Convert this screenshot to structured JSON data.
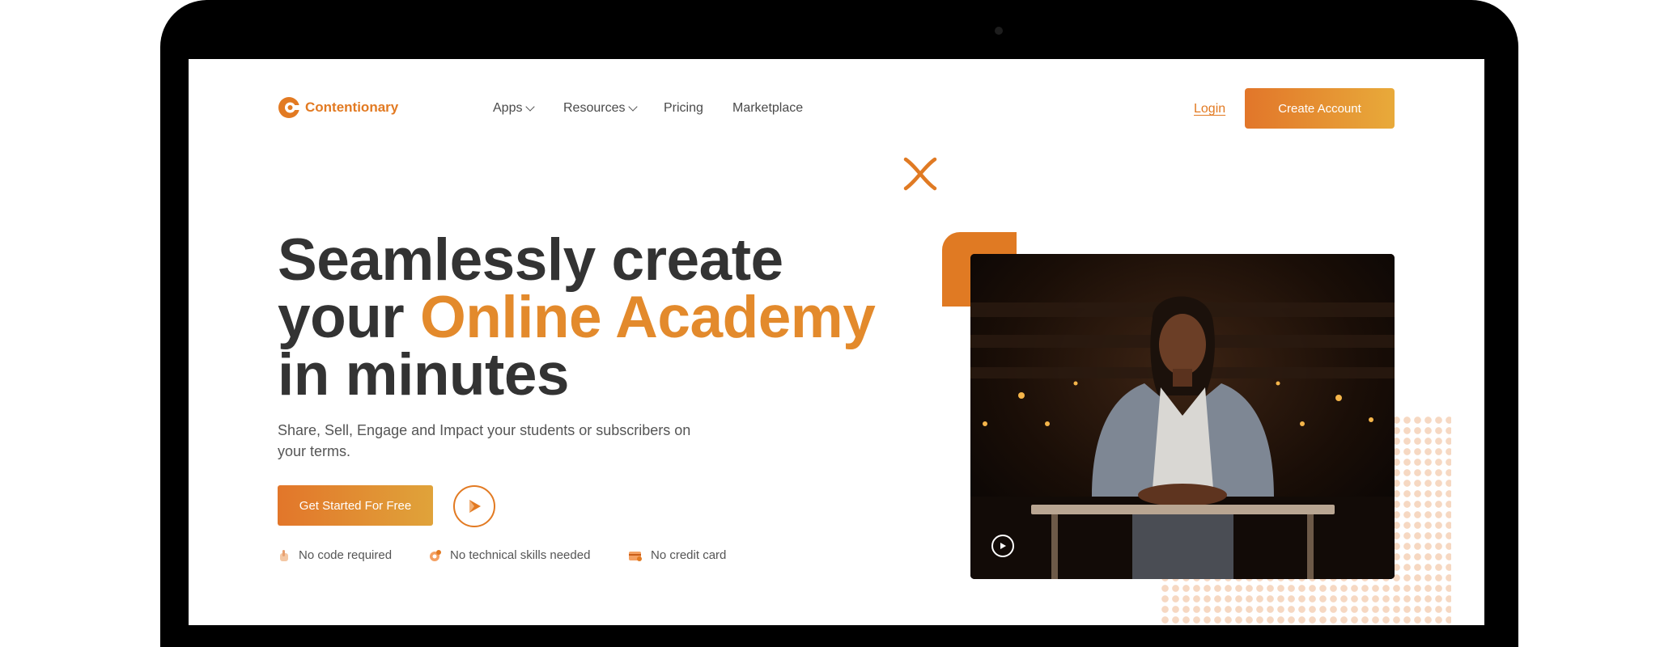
{
  "brand": {
    "name": "Contentionary",
    "accent": "#E27A22",
    "accent_gold": "#E38A2C"
  },
  "nav": {
    "items": [
      {
        "label": "Apps",
        "has_dropdown": true
      },
      {
        "label": "Resources",
        "has_dropdown": true
      },
      {
        "label": "Pricing",
        "has_dropdown": false
      },
      {
        "label": "Marketplace",
        "has_dropdown": false
      }
    ],
    "login": "Login",
    "create_account": "Create Account"
  },
  "hero": {
    "line1": "Seamlessly create",
    "line2_plain": "your ",
    "line2_accent": "Online Academy",
    "line3": "in minutes",
    "subtitle": "Share, Sell, Engage and Impact your students or subscribers on your terms.",
    "cta": "Get Started For Free"
  },
  "features": [
    {
      "icon": "pointer-hand-icon",
      "label": "No code required"
    },
    {
      "icon": "gear-person-icon",
      "label": "No technical skills needed"
    },
    {
      "icon": "credit-card-icon",
      "label": "No credit card"
    }
  ],
  "icons": {
    "logo": "contentionary-logo-icon",
    "play": "play-icon",
    "x_mark": "x-mark-icon"
  }
}
